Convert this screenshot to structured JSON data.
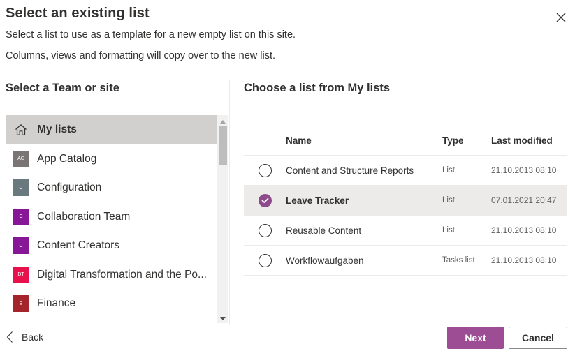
{
  "dialog": {
    "title": "Select an existing list",
    "subtitle_1": "Select a list to use as a template for a new empty list on this site.",
    "subtitle_2": "Columns, views and formatting will copy over to the new list.",
    "close_icon": "close-icon"
  },
  "left_panel": {
    "heading": "Select a Team or site",
    "items": [
      {
        "label": "My lists",
        "icon": "home-icon",
        "selected": true
      },
      {
        "label": "App Catalog",
        "badge": "AC",
        "badge_color": "#7a7574"
      },
      {
        "label": "Configuration",
        "badge": "C",
        "badge_color": "#69797e"
      },
      {
        "label": "Collaboration Team",
        "badge": "C",
        "badge_color": "#881798"
      },
      {
        "label": "Content Creators",
        "badge": "C",
        "badge_color": "#881798"
      },
      {
        "label": "Digital Transformation and the Po...",
        "badge": "DT",
        "badge_color": "#e8114b"
      },
      {
        "label": "Finance",
        "badge": "E",
        "badge_color": "#a4262c"
      }
    ]
  },
  "right_panel": {
    "heading": "Choose a list from My lists",
    "columns": {
      "name": "Name",
      "type": "Type",
      "modified": "Last modified"
    },
    "rows": [
      {
        "name": "Content and Structure Reports",
        "type": "List",
        "modified": "21.10.2013 08:10",
        "selected": false
      },
      {
        "name": "Leave Tracker",
        "type": "List",
        "modified": "07.01.2021 20:47",
        "selected": true
      },
      {
        "name": "Reusable Content",
        "type": "List",
        "modified": "21.10.2013 08:10",
        "selected": false
      },
      {
        "name": "Workflowaufgaben",
        "type": "Tasks list",
        "modified": "21.10.2013 08:10",
        "selected": false
      }
    ]
  },
  "footer": {
    "back_label": "Back",
    "next_label": "Next",
    "cancel_label": "Cancel"
  },
  "colors": {
    "accent": "#9c4d94",
    "selected_row": "#edebe9",
    "selected_site": "#d2d0ce"
  }
}
